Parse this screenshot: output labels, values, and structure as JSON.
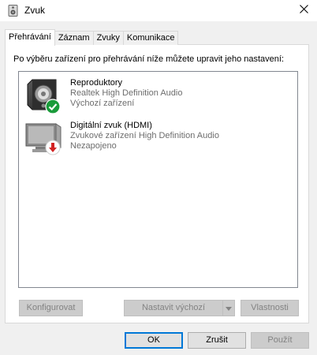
{
  "window": {
    "title": "Zvuk",
    "icon": "speaker-app-icon",
    "close_icon": "close-icon"
  },
  "tabs": [
    {
      "label": "Přehrávání",
      "active": true
    },
    {
      "label": "Záznam",
      "active": false
    },
    {
      "label": "Zvuky",
      "active": false
    },
    {
      "label": "Komunikace",
      "active": false
    }
  ],
  "instruction": "Po výběru zařízení pro přehrávání níže můžete upravit jeho nastavení:",
  "devices": [
    {
      "name": "Reproduktory",
      "driver": "Realtek High Definition Audio",
      "status": "Výchozí zařízení",
      "icon": "speaker-icon",
      "status_icon": "green-check-icon"
    },
    {
      "name": "Digitální zvuk (HDMI)",
      "driver": "Zvukové zařízení High Definition Audio",
      "status": "Nezapojeno",
      "icon": "monitor-icon",
      "status_icon": "red-down-arrow-icon"
    }
  ],
  "panel_buttons": {
    "configure": "Konfigurovat",
    "set_default": "Nastavit výchozí",
    "properties": "Vlastnosti"
  },
  "dialog_buttons": {
    "ok": "OK",
    "cancel": "Zrušit",
    "apply": "Použít"
  },
  "colors": {
    "default_check": "#1a9b3a",
    "disconnected": "#d22222",
    "accent": "#0078d7"
  }
}
